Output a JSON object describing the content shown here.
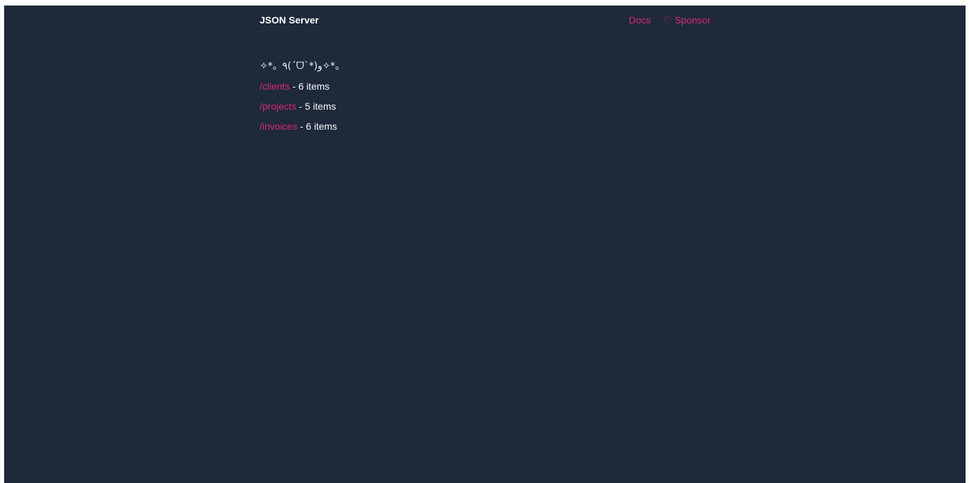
{
  "header": {
    "brand": "JSON Server",
    "nav": {
      "docs_label": "Docs",
      "sponsor_icon": "heart-icon",
      "sponsor_glyph": "♡",
      "sponsor_label": "Sponsor"
    }
  },
  "main": {
    "kaomoji": "✧*。٩(ˊᗜˋ*)و✧*。",
    "resources": [
      {
        "path": "/clients",
        "summary": " - 6 items"
      },
      {
        "path": "/projects",
        "summary": " - 5 items"
      },
      {
        "path": "/invoices",
        "summary": " - 6 items"
      }
    ]
  },
  "colors": {
    "background": "#1e293b",
    "accent": "#db2777",
    "text": "#f8fafc"
  }
}
